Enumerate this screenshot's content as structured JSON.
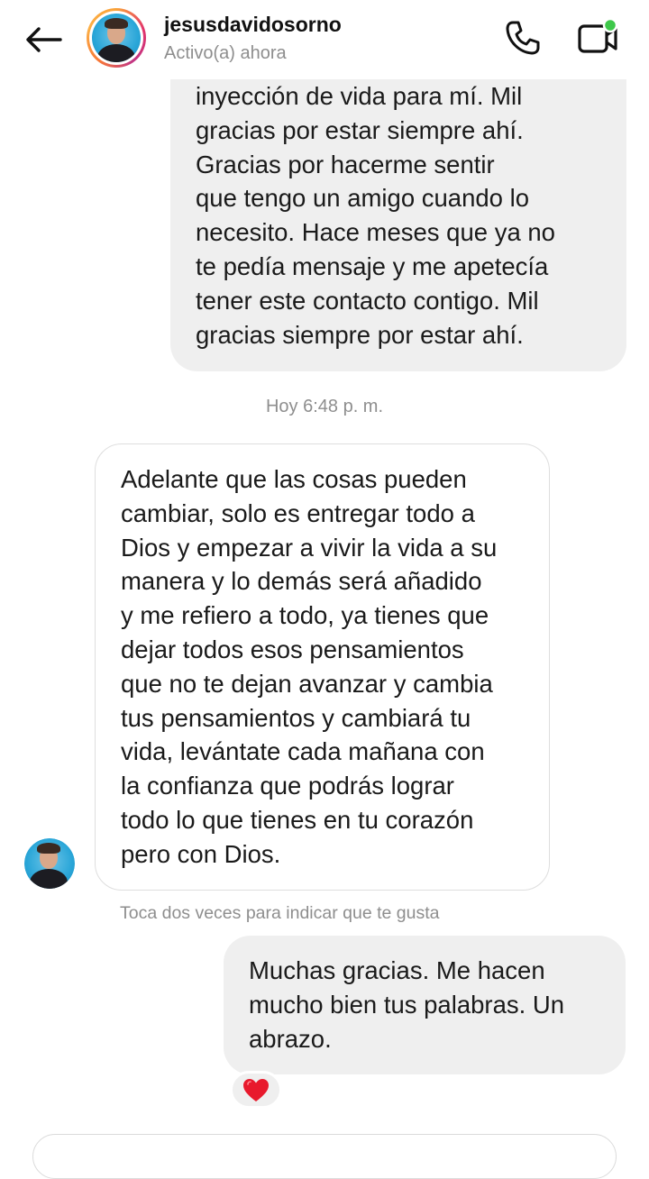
{
  "header": {
    "username": "jesusdavidosorno",
    "status": "Activo(a) ahora",
    "back_icon": "arrow-left-icon",
    "call_icon": "phone-icon",
    "video_icon": "video-camera-icon",
    "online_color": "#3ec84a"
  },
  "messages": [
    {
      "direction": "sent",
      "text": "inyección de vida para mí. Mil\ngracias por estar siempre ahí.\nGracias por hacerme sentir\nque tengo un amigo cuando lo\nnecesito. Hace meses que ya no\nte pedía mensaje y me apetecía\ntener este contacto contigo. Mil\ngracias siempre por estar ahí."
    },
    {
      "direction": "received",
      "text": "Adelante que las cosas pueden\ncambiar, solo es entregar todo a\nDios y empezar a vivir la vida a su\nmanera y lo demás será añadido\ny me refiero a todo, ya tienes que\ndejar todos esos pensamientos\nque no te dejan avanzar y cambia\ntus pensamientos y cambiará tu\nvida, levántate cada mañana con\nla confianza que podrás lograr\ntodo lo que tienes en tu corazón\npero con Dios."
    },
    {
      "direction": "sent",
      "text": "Muchas gracias.  Me hacen\nmucho bien tus palabras.  Un\nabrazo.",
      "reaction": "heart-icon"
    }
  ],
  "timestamp": "Hoy 6:48 p. m.",
  "hint": "Toca dos veces para indicar que te gusta",
  "colors": {
    "sent_bubble": "#efefef",
    "received_border": "#dedede",
    "muted_text": "#8e8e8e",
    "heart": "#e8192c"
  }
}
